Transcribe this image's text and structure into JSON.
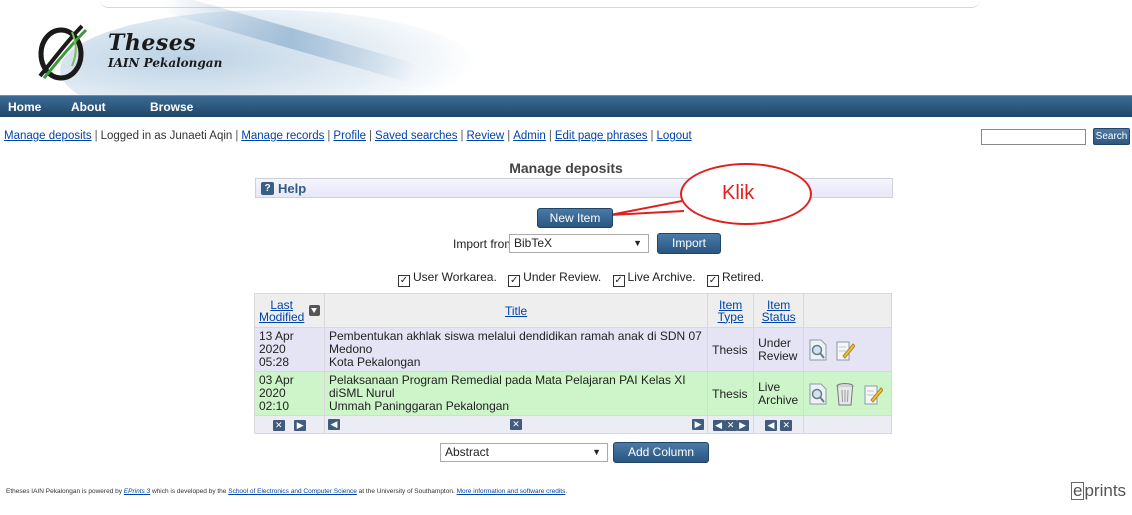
{
  "logo": {
    "title": "Theses",
    "subtitle": "IAIN Pekalongan"
  },
  "nav": {
    "items": [
      "Home",
      "About",
      "Browse"
    ]
  },
  "loginbar": {
    "manage_deposits": "Manage deposits",
    "logged_in": "Logged in as Junaeti Aqin",
    "manage_records": "Manage records",
    "profile": "Profile",
    "saved_searches": "Saved searches",
    "review": "Review",
    "admin": "Admin",
    "edit_phrases": "Edit page phrases",
    "logout": "Logout",
    "search_button": "Search",
    "search_value": ""
  },
  "page_title": "Manage deposits",
  "help": {
    "label": "Help",
    "icon": "?"
  },
  "new_item_button": "New Item",
  "import": {
    "label": "Import from",
    "selected": "BibTeX",
    "button": "Import"
  },
  "filters": [
    {
      "label": "User Workarea.",
      "checked": true
    },
    {
      "label": "Under Review.",
      "checked": true
    },
    {
      "label": "Live Archive.",
      "checked": true
    },
    {
      "label": "Retired.",
      "checked": true
    }
  ],
  "table": {
    "headers": {
      "last_modified_1": "Last",
      "last_modified_2": "Modified",
      "title": "Title",
      "type_1": "Item",
      "type_2": "Type",
      "status_1": "Item",
      "status_2": "Status"
    },
    "rows": [
      {
        "date": "13 Apr 2020",
        "time": "05:28",
        "title_1": "Pembentukan akhlak siswa melalui dendidikan ramah anak di SDN 07 Medono",
        "title_2": "Kota Pekalongan",
        "type": "Thesis",
        "status_1": "Under",
        "status_2": "Review"
      },
      {
        "date": "03 Apr 2020",
        "time": "02:10",
        "title_1": "Pelaksanaan Program Remedial pada Mata Pelajaran PAI Kelas XI diSML Nurul",
        "title_2": "Ummah Paninggaran Pekalongan",
        "type": "Thesis",
        "status_1": "Live",
        "status_2": "Archive"
      }
    ]
  },
  "column_select": {
    "selected": "Abstract",
    "button": "Add Column"
  },
  "callout": "Klik",
  "footer": {
    "part1": "Etheses IAIN Pekalongan is powered by ",
    "eprints_link": "EPrints 3",
    "part2": " which is developed by the ",
    "school_link": "School of Electronics and Computer Science",
    "part3": " at the University of Southampton. ",
    "more_link": "More information and software credits",
    "part4": "."
  },
  "eprints_logo": "eprints",
  "colors": {
    "nav": "#2a5680",
    "live_row": "#cdf5c9",
    "review_row": "#e4e4f4",
    "callout": "#e02020"
  }
}
